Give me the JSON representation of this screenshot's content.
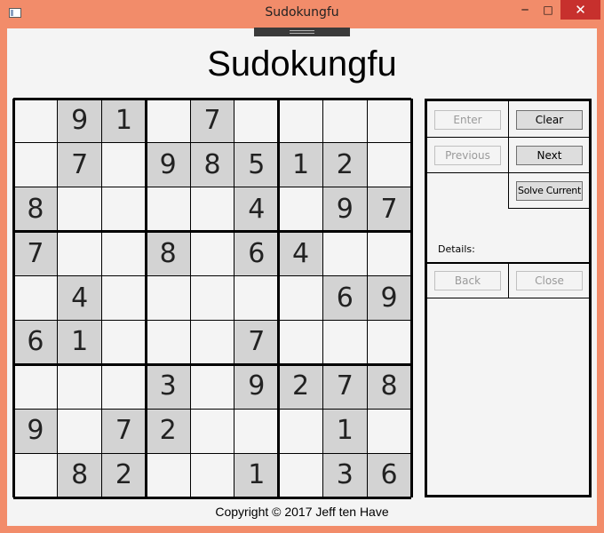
{
  "window": {
    "title": "Sudokungfu",
    "minimize_glyph": "─",
    "maximize_glyph": "□",
    "close_glyph": "✕"
  },
  "app_title": "Sudokungfu",
  "grid": [
    [
      "",
      "9",
      "1",
      "",
      "7",
      "",
      "",
      "",
      ""
    ],
    [
      "",
      "7",
      "",
      "9",
      "8",
      "5",
      "1",
      "2",
      ""
    ],
    [
      "8",
      "",
      "",
      "",
      "",
      "4",
      "",
      "9",
      "7"
    ],
    [
      "7",
      "",
      "",
      "8",
      "",
      "6",
      "4",
      "",
      ""
    ],
    [
      "",
      "4",
      "",
      "",
      "",
      "",
      "",
      "6",
      "9"
    ],
    [
      "6",
      "1",
      "",
      "",
      "",
      "7",
      "",
      "",
      ""
    ],
    [
      "",
      "",
      "",
      "3",
      "",
      "9",
      "2",
      "7",
      "8"
    ],
    [
      "9",
      "",
      "7",
      "2",
      "",
      "",
      "",
      "1",
      ""
    ],
    [
      "",
      "8",
      "2",
      "",
      "",
      "1",
      "",
      "3",
      "6"
    ]
  ],
  "panel": {
    "enter": "Enter",
    "clear": "Clear",
    "previous": "Previous",
    "next": "Next",
    "solve_current": "Solve Current",
    "details_label": "Details:",
    "back": "Back",
    "close": "Close"
  },
  "colors": {
    "titlebar": "#f28c6a",
    "given_cell": "#d3d3d3",
    "close_button": "#c7302d"
  },
  "footer": {
    "copyright": "Copyright © 2017 Jeff ten Have"
  }
}
